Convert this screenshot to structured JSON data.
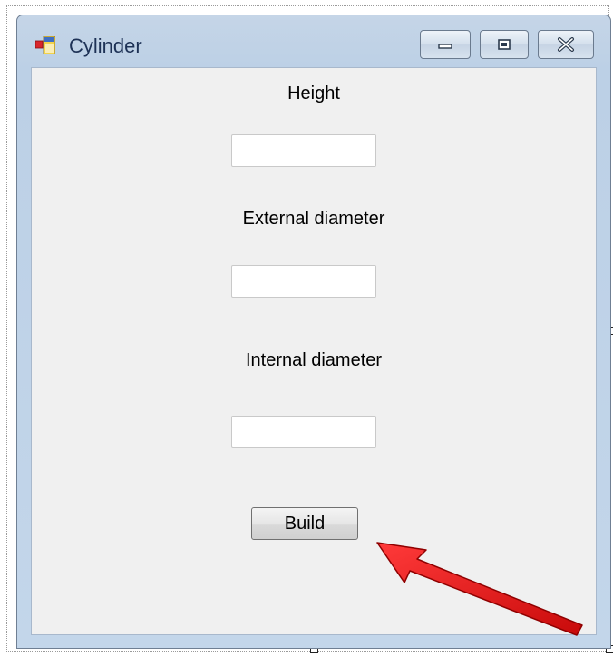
{
  "window": {
    "title": "Cylinder"
  },
  "form": {
    "height_label": "Height",
    "height_value": "",
    "external_diameter_label": "External diameter",
    "external_diameter_value": "",
    "internal_diameter_label": "Internal diameter",
    "internal_diameter_value": "",
    "build_label": "Build"
  },
  "icons": {
    "app": "form-app-icon",
    "minimize": "minimize-icon",
    "maximize": "maximize-icon",
    "close": "close-icon",
    "annotation": "red-arrow-icon"
  },
  "colors": {
    "annotation_arrow": "#e01010",
    "title_text": "#1e3256",
    "client_background": "#f0f0f0",
    "frame": "#c3d6ea"
  }
}
